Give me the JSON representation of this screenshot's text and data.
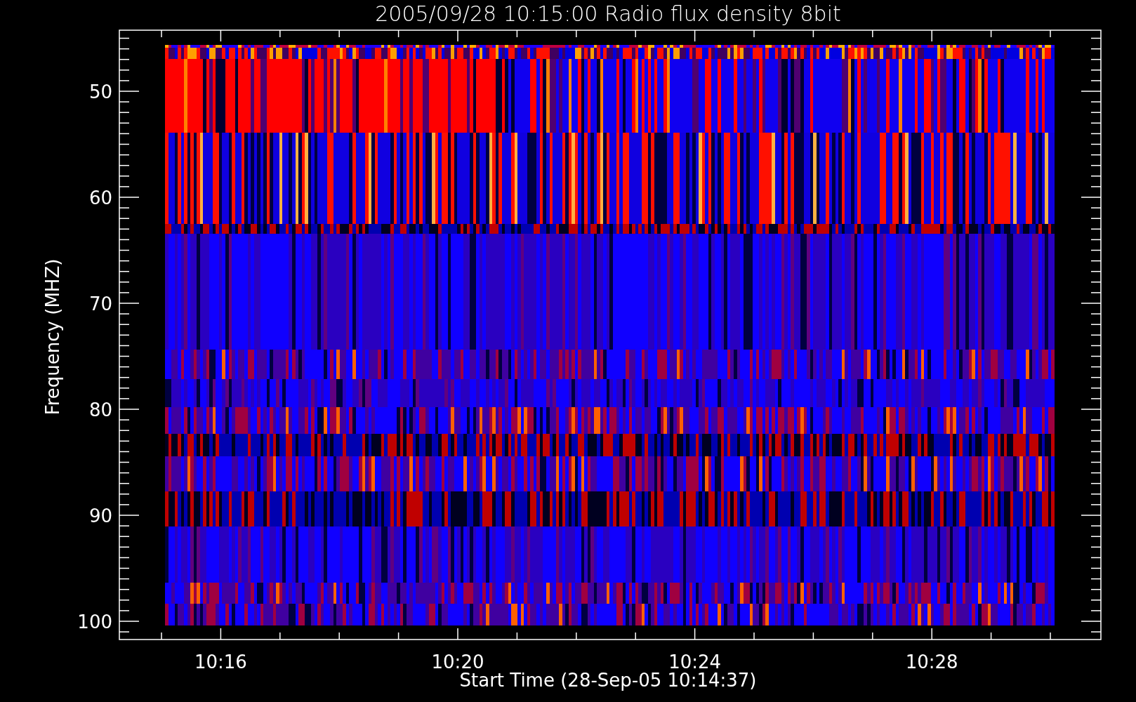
{
  "plot": {
    "title": "2005/09/28 10:15:00 Radio flux density 8bit",
    "ylabel": "Frequency (MHZ)",
    "xlabel": "Start Time (28-Sep-05 10:14:37)",
    "yticks": [
      "50",
      "60",
      "70",
      "80",
      "90",
      "100"
    ],
    "xticks": [
      "10:16",
      "10:20",
      "10:24",
      "10:28"
    ]
  }
}
